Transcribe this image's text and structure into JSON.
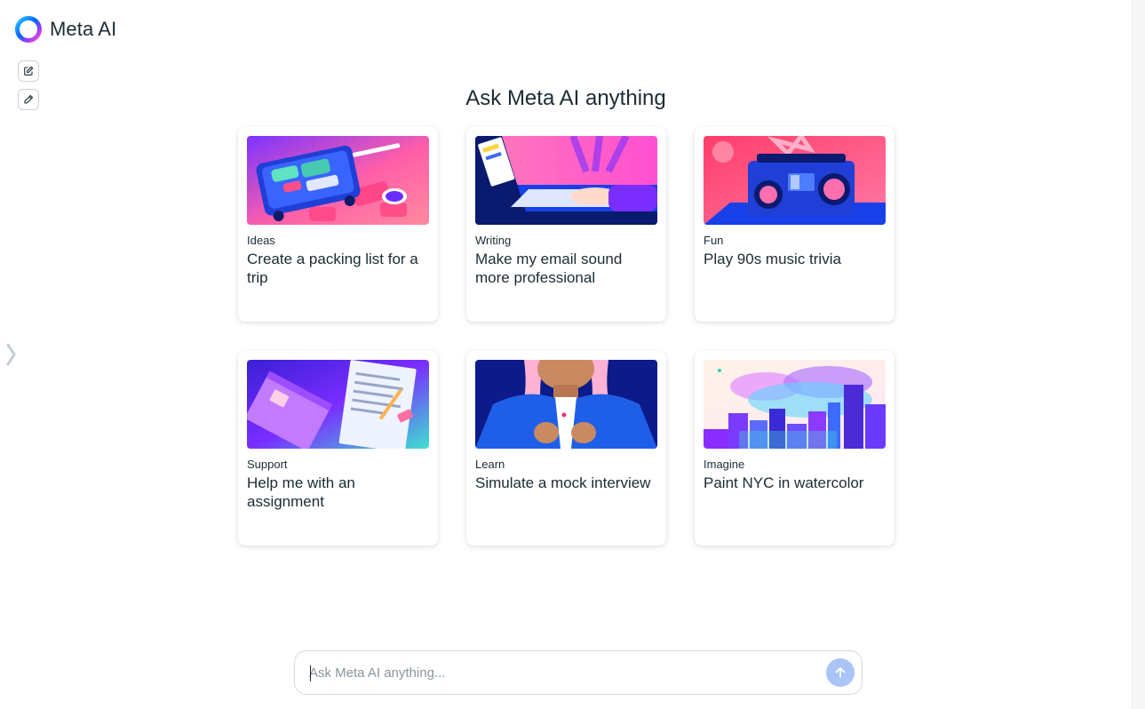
{
  "app": {
    "name": "Meta AI"
  },
  "sidebar": {
    "new_chat_icon": "new-chat-icon",
    "edit_icon": "pencil-icon",
    "expand_icon": "chevron-right-icon"
  },
  "main": {
    "headline": "Ask Meta AI anything",
    "cards": [
      {
        "category": "Ideas",
        "title": "Create a packing list for a trip",
        "art": "suitcase"
      },
      {
        "category": "Writing",
        "title": "Make my email sound more professional",
        "art": "laptop"
      },
      {
        "category": "Fun",
        "title": "Play 90s music trivia",
        "art": "boombox"
      },
      {
        "category": "Support",
        "title": "Help me with an assignment",
        "art": "notebook"
      },
      {
        "category": "Learn",
        "title": "Simulate a mock interview",
        "art": "interview"
      },
      {
        "category": "Imagine",
        "title": "Paint NYC in watercolor",
        "art": "city-watercolor"
      }
    ]
  },
  "composer": {
    "placeholder": "Ask Meta AI anything...",
    "value": "",
    "send_icon": "arrow-up-icon"
  },
  "colors": {
    "text": "#1c2b33",
    "send_button": "#a9c4f5",
    "border": "#d5dbe1"
  }
}
